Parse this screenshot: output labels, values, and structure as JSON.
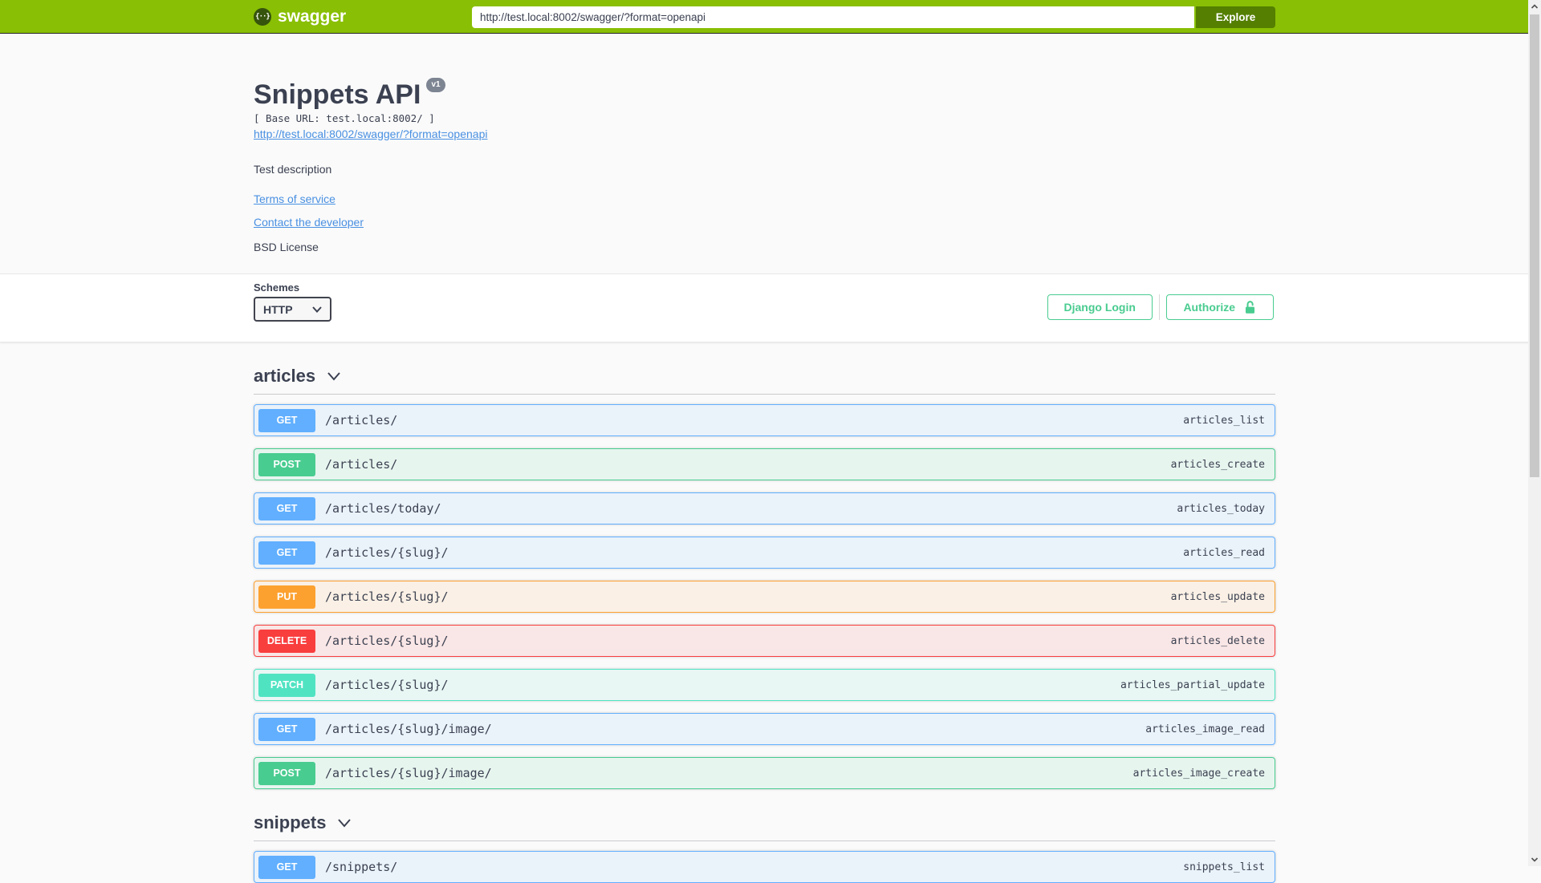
{
  "topbar": {
    "brand": "swagger",
    "url_value": "http://test.local:8002/swagger/?format=openapi",
    "explore_label": "Explore"
  },
  "info": {
    "title": "Snippets API",
    "version_badge": "v1",
    "base_url_text": "[ Base URL: test.local:8002/ ]",
    "spec_link": "http://test.local:8002/swagger/?format=openapi",
    "description": "Test description",
    "terms_link": "Terms of service",
    "contact_link": "Contact the developer",
    "license_text": "BSD License"
  },
  "scheme": {
    "label": "Schemes",
    "selected": "HTTP",
    "django_login_label": "Django Login",
    "authorize_label": "Authorize"
  },
  "sections": [
    {
      "name": "articles",
      "operations": [
        {
          "method": "GET",
          "path": "/articles/",
          "operation_id": "articles_list"
        },
        {
          "method": "POST",
          "path": "/articles/",
          "operation_id": "articles_create"
        },
        {
          "method": "GET",
          "path": "/articles/today/",
          "operation_id": "articles_today"
        },
        {
          "method": "GET",
          "path": "/articles/{slug}/",
          "operation_id": "articles_read"
        },
        {
          "method": "PUT",
          "path": "/articles/{slug}/",
          "operation_id": "articles_update"
        },
        {
          "method": "DELETE",
          "path": "/articles/{slug}/",
          "operation_id": "articles_delete"
        },
        {
          "method": "PATCH",
          "path": "/articles/{slug}/",
          "operation_id": "articles_partial_update"
        },
        {
          "method": "GET",
          "path": "/articles/{slug}/image/",
          "operation_id": "articles_image_read"
        },
        {
          "method": "POST",
          "path": "/articles/{slug}/image/",
          "operation_id": "articles_image_create"
        }
      ]
    },
    {
      "name": "snippets",
      "operations": [
        {
          "method": "GET",
          "path": "/snippets/",
          "operation_id": "snippets_list"
        }
      ]
    }
  ],
  "colors": {
    "get": "#61affe",
    "post": "#49cc90",
    "put": "#fca130",
    "delete": "#f93e3e",
    "patch": "#50e3c2",
    "topbar_green": "#89bf04",
    "explore_green": "#547f00",
    "accent_green": "#49cc90",
    "link_blue": "#4990e2",
    "text_dark": "#3b4151",
    "version_badge_gray": "#7d8492"
  }
}
